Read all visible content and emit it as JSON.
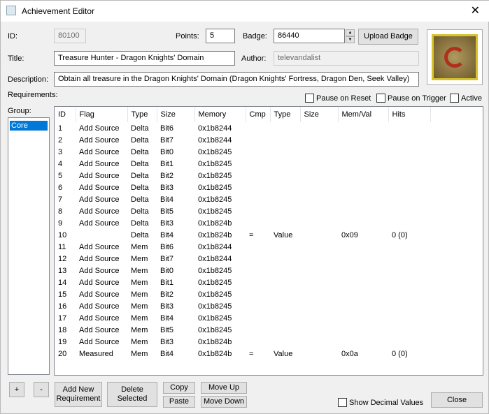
{
  "window": {
    "title": "Achievement Editor",
    "close": "✕"
  },
  "form": {
    "id_label": "ID:",
    "id": "80100",
    "points_label": "Points:",
    "points": "5",
    "badge_label": "Badge:",
    "badge": "86440",
    "upload_badge": "Upload Badge",
    "title_label": "Title:",
    "title": "Treasure Hunter - Dragon Knights' Domain",
    "author_label": "Author:",
    "author": "televandalist",
    "description_label": "Description:",
    "description": "Obtain all treasure in the Dragon Knights' Domain (Dragon Knights' Fortress, Dragon Den, Seek Valley)",
    "requirements_label": "Requirements:",
    "group_label": "Group:"
  },
  "options": {
    "pause_on_reset": "Pause on Reset",
    "pause_on_trigger": "Pause on Trigger",
    "active": "Active"
  },
  "groups": [
    "Core"
  ],
  "columns": [
    "ID",
    "Flag",
    "Type",
    "Size",
    "Memory",
    "Cmp",
    "Type",
    "Size",
    "Mem/Val",
    "Hits"
  ],
  "rows": [
    [
      "1",
      "Add Source",
      "Delta",
      "Bit6",
      "0x1b8244",
      "",
      "",
      "",
      "",
      ""
    ],
    [
      "2",
      "Add Source",
      "Delta",
      "Bit7",
      "0x1b8244",
      "",
      "",
      "",
      "",
      ""
    ],
    [
      "3",
      "Add Source",
      "Delta",
      "Bit0",
      "0x1b8245",
      "",
      "",
      "",
      "",
      ""
    ],
    [
      "4",
      "Add Source",
      "Delta",
      "Bit1",
      "0x1b8245",
      "",
      "",
      "",
      "",
      ""
    ],
    [
      "5",
      "Add Source",
      "Delta",
      "Bit2",
      "0x1b8245",
      "",
      "",
      "",
      "",
      ""
    ],
    [
      "6",
      "Add Source",
      "Delta",
      "Bit3",
      "0x1b8245",
      "",
      "",
      "",
      "",
      ""
    ],
    [
      "7",
      "Add Source",
      "Delta",
      "Bit4",
      "0x1b8245",
      "",
      "",
      "",
      "",
      ""
    ],
    [
      "8",
      "Add Source",
      "Delta",
      "Bit5",
      "0x1b8245",
      "",
      "",
      "",
      "",
      ""
    ],
    [
      "9",
      "Add Source",
      "Delta",
      "Bit3",
      "0x1b824b",
      "",
      "",
      "",
      "",
      ""
    ],
    [
      "10",
      "",
      "Delta",
      "Bit4",
      "0x1b824b",
      "=",
      "Value",
      "",
      "0x09",
      "0 (0)"
    ],
    [
      "11",
      "Add Source",
      "Mem",
      "Bit6",
      "0x1b8244",
      "",
      "",
      "",
      "",
      ""
    ],
    [
      "12",
      "Add Source",
      "Mem",
      "Bit7",
      "0x1b8244",
      "",
      "",
      "",
      "",
      ""
    ],
    [
      "13",
      "Add Source",
      "Mem",
      "Bit0",
      "0x1b8245",
      "",
      "",
      "",
      "",
      ""
    ],
    [
      "14",
      "Add Source",
      "Mem",
      "Bit1",
      "0x1b8245",
      "",
      "",
      "",
      "",
      ""
    ],
    [
      "15",
      "Add Source",
      "Mem",
      "Bit2",
      "0x1b8245",
      "",
      "",
      "",
      "",
      ""
    ],
    [
      "16",
      "Add Source",
      "Mem",
      "Bit3",
      "0x1b8245",
      "",
      "",
      "",
      "",
      ""
    ],
    [
      "17",
      "Add Source",
      "Mem",
      "Bit4",
      "0x1b8245",
      "",
      "",
      "",
      "",
      ""
    ],
    [
      "18",
      "Add Source",
      "Mem",
      "Bit5",
      "0x1b8245",
      "",
      "",
      "",
      "",
      ""
    ],
    [
      "19",
      "Add Source",
      "Mem",
      "Bit3",
      "0x1b824b",
      "",
      "",
      "",
      "",
      ""
    ],
    [
      "20",
      "Measured",
      "Mem",
      "Bit4",
      "0x1b824b",
      "=",
      "Value",
      "",
      "0x0a",
      "0 (0)"
    ]
  ],
  "buttons": {
    "add_group": "+",
    "remove_group": "-",
    "add_new": "Add New Requirement",
    "delete_selected": "Delete Selected",
    "copy": "Copy",
    "paste": "Paste",
    "move_up": "Move Up",
    "move_down": "Move Down",
    "show_decimal": "Show Decimal Values",
    "close": "Close"
  }
}
